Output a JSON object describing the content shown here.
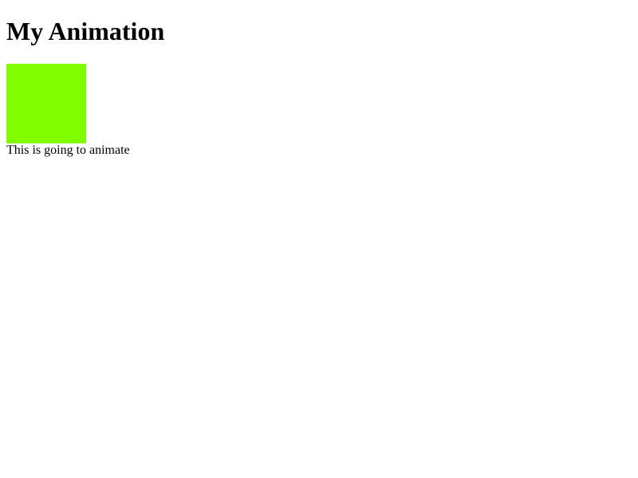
{
  "page": {
    "title": "My Animation",
    "caption": "This is going to animate"
  },
  "box": {
    "color": "#80ff00"
  }
}
